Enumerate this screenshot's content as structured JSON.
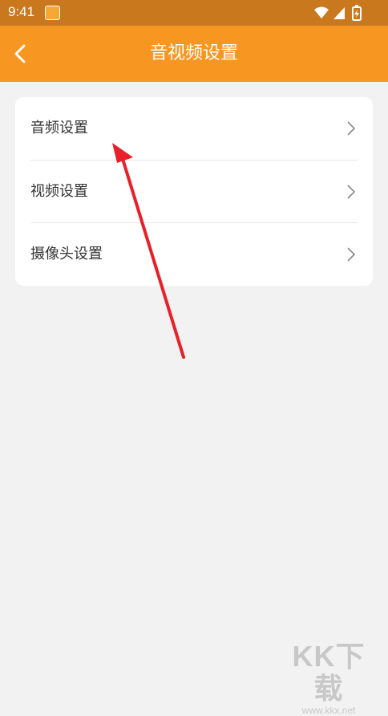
{
  "status_bar": {
    "time": "9:41",
    "icons": [
      "app-notification-icon",
      "wifi-icon",
      "signal-icon",
      "battery-charging-icon"
    ]
  },
  "app_bar": {
    "back_icon": "chevron-left-icon",
    "title": "音视频设置"
  },
  "settings": {
    "items": [
      {
        "label": "音频设置",
        "icon": "chevron-right-icon"
      },
      {
        "label": "视频设置",
        "icon": "chevron-right-icon"
      },
      {
        "label": "摄像头设置",
        "icon": "chevron-right-icon"
      }
    ]
  },
  "colors": {
    "status_bar": "#c9781e",
    "app_bar": "#f79621",
    "annotation_arrow": "#e8202a"
  },
  "watermark": {
    "logo": "KK下载",
    "url": "www.kkx.net"
  }
}
